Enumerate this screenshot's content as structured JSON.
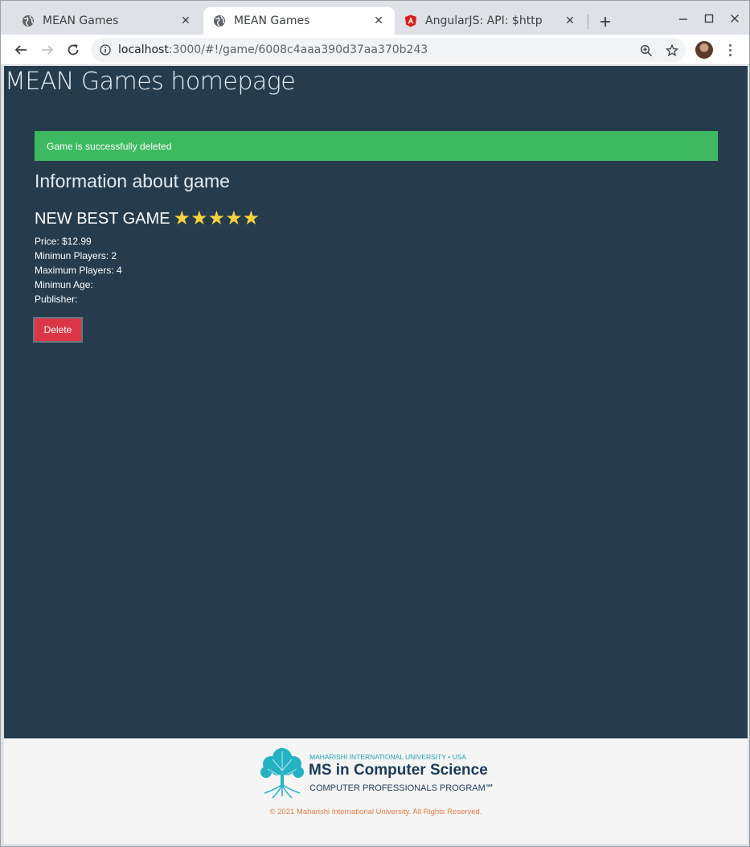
{
  "browser": {
    "tabs": [
      {
        "title": "MEAN Games",
        "icon": "globe-icon",
        "active": false
      },
      {
        "title": "MEAN Games",
        "icon": "globe-icon",
        "active": true
      },
      {
        "title": "AngularJS: API: $http",
        "icon": "angular-icon",
        "active": false
      }
    ],
    "url_host": "localhost",
    "url_path": ":3000/#!/game/6008c4aaa390d37aa370b243"
  },
  "page": {
    "title": "MEAN Games homepage",
    "alert": "Game is successfully deleted",
    "section_title": "Information about game",
    "game": {
      "name": "NEW BEST GAME",
      "rating": 5,
      "price": "Price: $12.99",
      "min_players": "Minimun Players: 2",
      "max_players": "Maximum Players: 4",
      "min_age": "Minimun Age:",
      "publisher": "Publisher:"
    },
    "delete_label": "Delete"
  },
  "footer": {
    "logo_line1": "MAHARISHI INTERNATIONAL UNIVERSITY • USA",
    "logo_line2": "MS in Computer Science",
    "logo_line3": "COMPUTER PROFESSIONALS PROGRAM℠",
    "copyright": "© 2021 Maharishi International University. All Rights Reserved."
  },
  "colors": {
    "page_bg": "#263c4d",
    "alert_bg": "#3dba61",
    "delete_bg": "#dc3545",
    "star": "#f9d23c",
    "copyright": "#e07b43"
  }
}
